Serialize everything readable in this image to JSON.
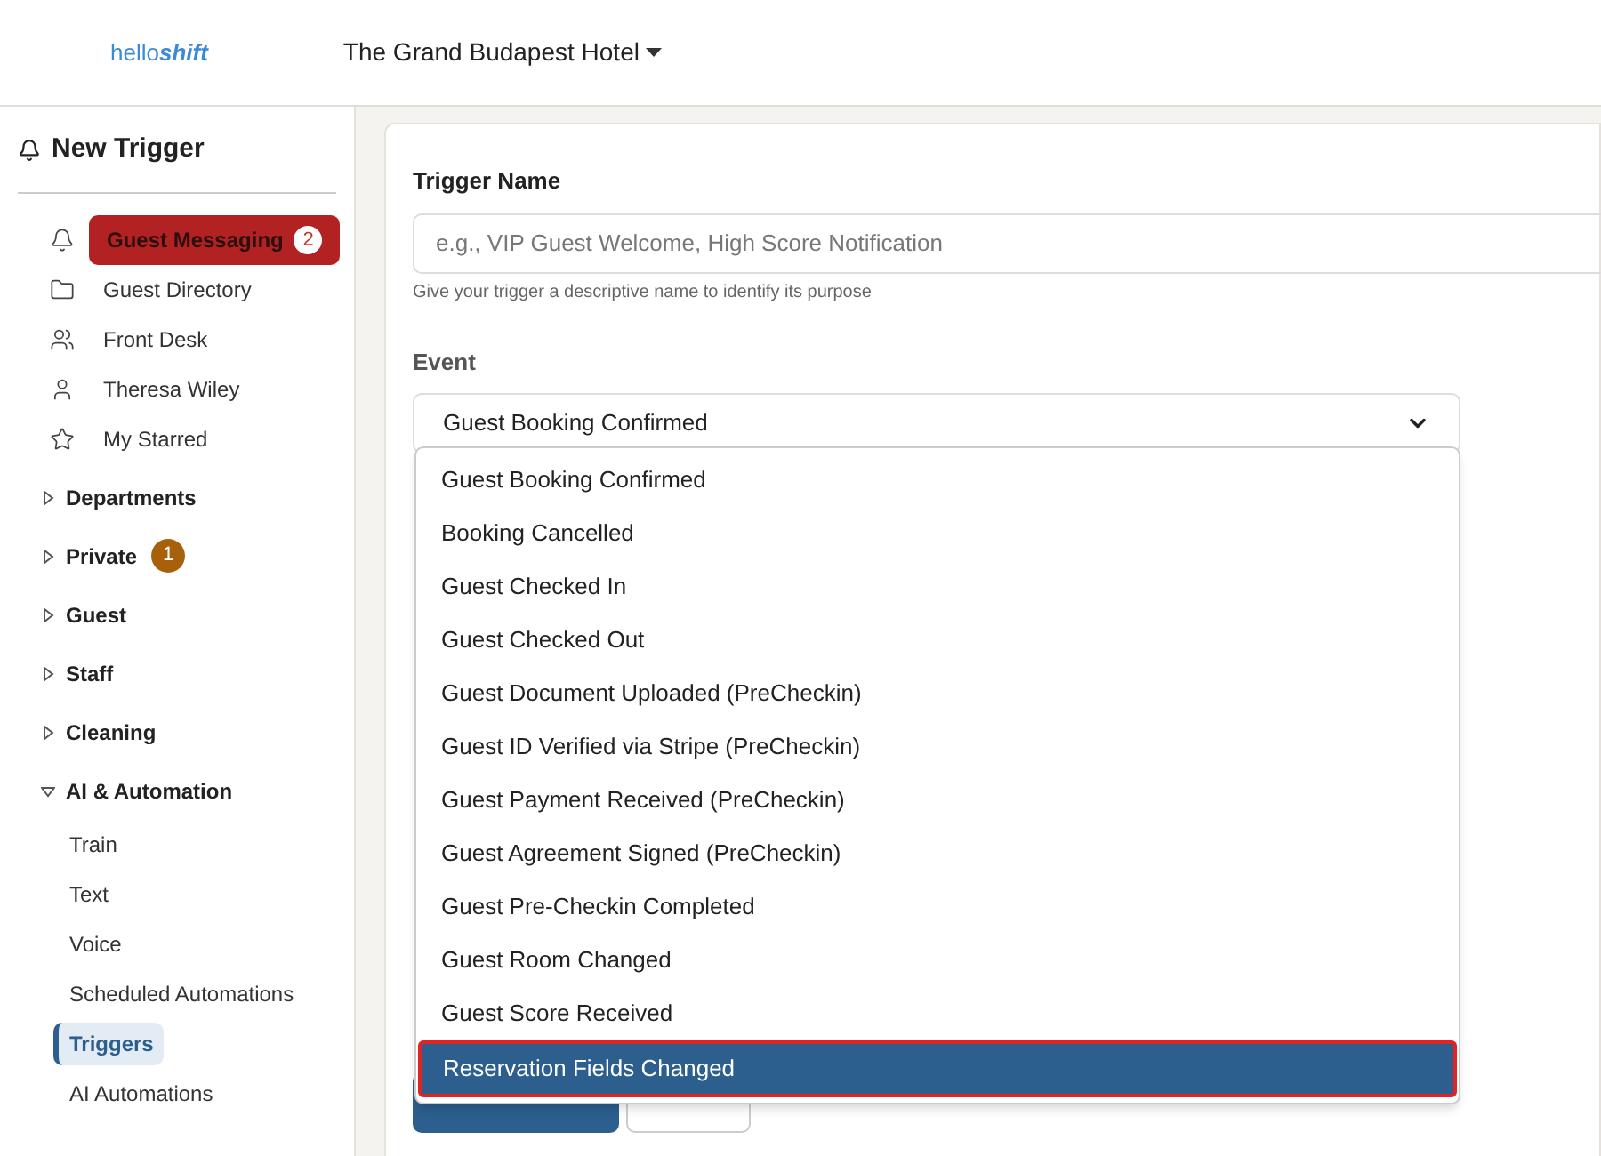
{
  "header": {
    "logo": {
      "plain": "hello",
      "bold": "shift"
    },
    "property": "The Grand Budapest Hotel"
  },
  "sidebar": {
    "title": "New Trigger",
    "channels": [
      {
        "label": "Guest Messaging",
        "selected": true,
        "badge": "2"
      },
      {
        "label": "Guest Directory",
        "selected": false
      },
      {
        "label": "Front Desk",
        "selected": false
      },
      {
        "label": "Theresa Wiley",
        "selected": false
      },
      {
        "label": "My Starred",
        "selected": false
      }
    ],
    "sections": [
      {
        "label": "Departments",
        "expanded": false
      },
      {
        "label": "Private",
        "expanded": false,
        "badge": "1"
      },
      {
        "label": "Guest",
        "expanded": false
      },
      {
        "label": "Staff",
        "expanded": false
      },
      {
        "label": "Cleaning",
        "expanded": false
      },
      {
        "label": "AI & Automation",
        "expanded": true,
        "children": [
          {
            "label": "Train",
            "selected": false
          },
          {
            "label": "Text",
            "selected": false
          },
          {
            "label": "Voice",
            "selected": false
          },
          {
            "label": "Scheduled Automations",
            "selected": false
          },
          {
            "label": "Triggers",
            "selected": true
          },
          {
            "label": "AI Automations",
            "selected": false
          }
        ]
      }
    ]
  },
  "form": {
    "name_label": "Trigger Name",
    "name_placeholder": "e.g., VIP Guest Welcome, High Score Notification",
    "name_help": "Give your trigger a descriptive name to identify its purpose",
    "event_label": "Event",
    "event_value": "Guest Booking Confirmed",
    "event_options": [
      {
        "label": "Guest Booking Confirmed",
        "selected": false
      },
      {
        "label": "Booking Cancelled",
        "selected": false
      },
      {
        "label": "Guest Checked In",
        "selected": false
      },
      {
        "label": "Guest Checked Out",
        "selected": false
      },
      {
        "label": "Guest Document Uploaded (PreCheckin)",
        "selected": false
      },
      {
        "label": "Guest ID Verified via Stripe (PreCheckin)",
        "selected": false
      },
      {
        "label": "Guest Payment Received (PreCheckin)",
        "selected": false
      },
      {
        "label": "Guest Agreement Signed (PreCheckin)",
        "selected": false
      },
      {
        "label": "Guest Pre-Checkin Completed",
        "selected": false
      },
      {
        "label": "Guest Room Changed",
        "selected": false
      },
      {
        "label": "Guest Score Received",
        "selected": false
      },
      {
        "label": "Reservation Fields Changed",
        "selected": true
      }
    ],
    "buttons": [
      {
        "kind": "primary"
      },
      {
        "kind": "secondary"
      }
    ]
  }
}
